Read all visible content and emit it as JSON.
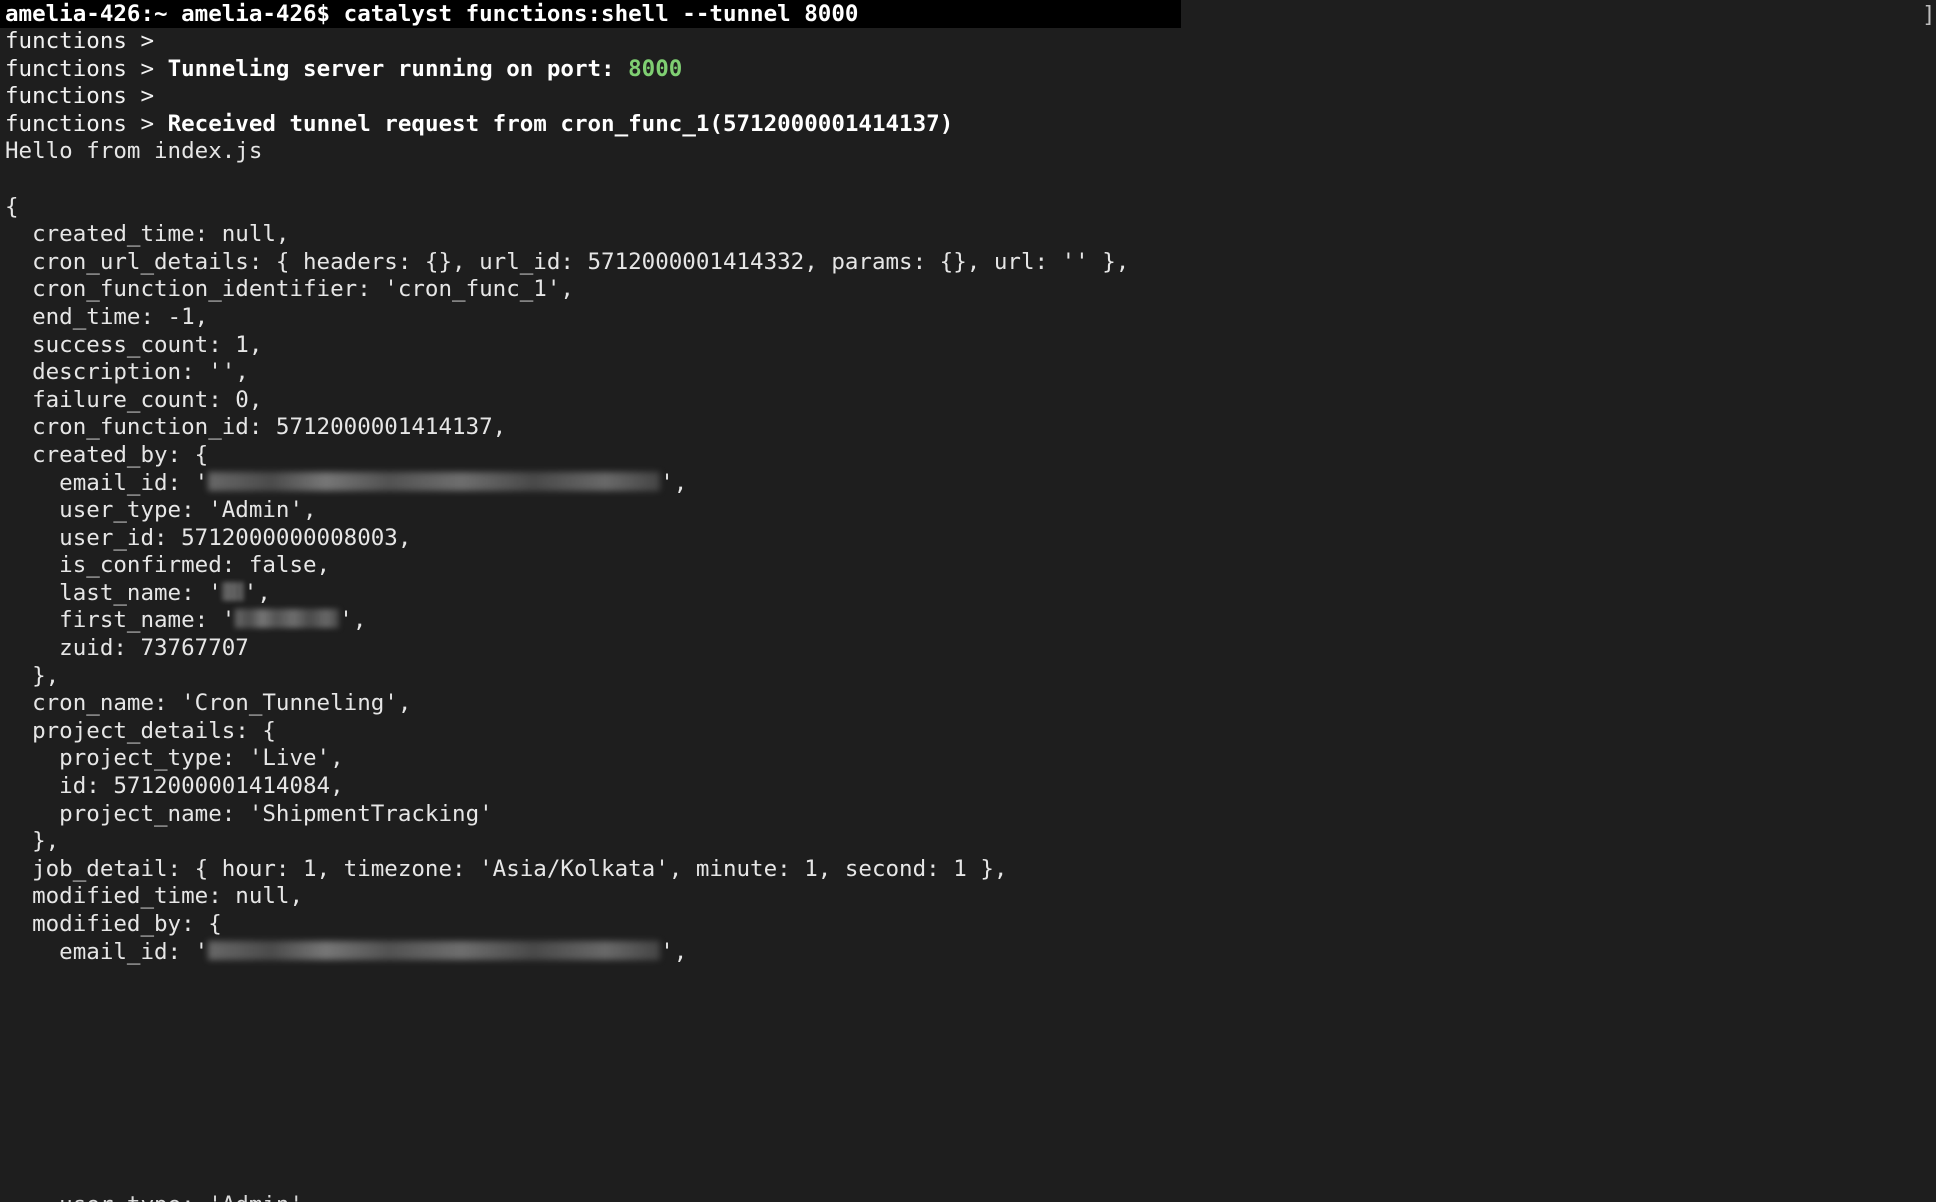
{
  "terminal": {
    "background_color": "#1e1e1e",
    "foreground_color": "#e8e8e8",
    "prompt_band_color": "#000000",
    "accent_port_color": "#7fcf72",
    "command_line": "amelia-426:~ amelia-426$ catalyst functions:shell --tunnel 8000",
    "edge_glyph": "]"
  },
  "log": {
    "prefix": "functions > ",
    "lines": [
      {
        "prefix": "functions > ",
        "message": "",
        "port": ""
      },
      {
        "prefix": "functions > ",
        "message": "Tunneling server running on port: ",
        "port": "8000"
      },
      {
        "prefix": "functions > ",
        "message": "",
        "port": ""
      },
      {
        "prefix": "functions > ",
        "message": "Received tunnel request from cron_func_1(5712000001414137)",
        "port": ""
      }
    ],
    "stdout": "Hello from index.js"
  },
  "payload": {
    "lines": [
      "{",
      "  created_time: null,",
      "  cron_url_details: { headers: {}, url_id: 5712000001414332, params: {}, url: '' },",
      "  cron_function_identifier: 'cron_func_1',",
      "  end_time: -1,",
      "  success_count: 1,",
      "  description: '',",
      "  failure_count: 0,",
      "  cron_function_id: 5712000001414137,",
      "  created_by: {",
      "    user_type: 'Admin',",
      "    user_id: 5712000000008003,",
      "    is_confirmed: false,",
      "    zuid: 73767707",
      "  },",
      "  cron_name: 'Cron_Tunneling',",
      "  project_details: {",
      "    project_type: 'Live',",
      "    id: 5712000001414084,",
      "    project_name: 'ShipmentTracking'",
      "  },",
      "  job_detail: { hour: 1, timezone: 'Asia/Kolkata', minute: 1, second: 1 },",
      "  modified_time: null,",
      "  modified_by: {"
    ],
    "rows": {
      "open_brace": "{",
      "created_time": "  created_time: null,",
      "cron_url_details": "  cron_url_details: { headers: {}, url_id: 5712000001414332, params: {}, url: '' },",
      "cron_function_identifier": "  cron_function_identifier: 'cron_func_1',",
      "end_time": "  end_time: -1,",
      "success_count": "  success_count: 1,",
      "description": "  description: '',",
      "failure_count": "  failure_count: 0,",
      "cron_function_id": "  cron_function_id: 5712000001414137,",
      "created_by_open": "  created_by: {",
      "created_by_email_prefix": "    email_id: '",
      "created_by_email_suffix": "',",
      "created_by_user_type": "    user_type: 'Admin',",
      "created_by_user_id": "    user_id: 5712000000008003,",
      "created_by_is_confirmed": "    is_confirmed: false,",
      "created_by_last_name_prefix": "    last_name: '",
      "created_by_last_name_suffix": "',",
      "created_by_first_name_prefix": "    first_name: '",
      "created_by_first_name_suffix": "',",
      "created_by_zuid": "    zuid: 73767707",
      "created_by_close": "  },",
      "cron_name": "  cron_name: 'Cron_Tunneling',",
      "project_details_open": "  project_details: {",
      "project_type": "    project_type: 'Live',",
      "project_id": "    id: 5712000001414084,",
      "project_name": "    project_name: 'ShipmentTracking'",
      "project_details_close": "  },",
      "job_detail": "  job_detail: { hour: 1, timezone: 'Asia/Kolkata', minute: 1, second: 1 },",
      "modified_time": "  modified_time: null,",
      "modified_by_open": "  modified_by: {",
      "modified_by_email_prefix": "    email_id: '",
      "modified_by_email_suffix": "',",
      "modified_by_user_type": "    user_type: 'Admin',"
    },
    "redacted": {
      "email_id": "[redacted]",
      "last_name": "[redacted]",
      "first_name": "[redacted]"
    }
  }
}
